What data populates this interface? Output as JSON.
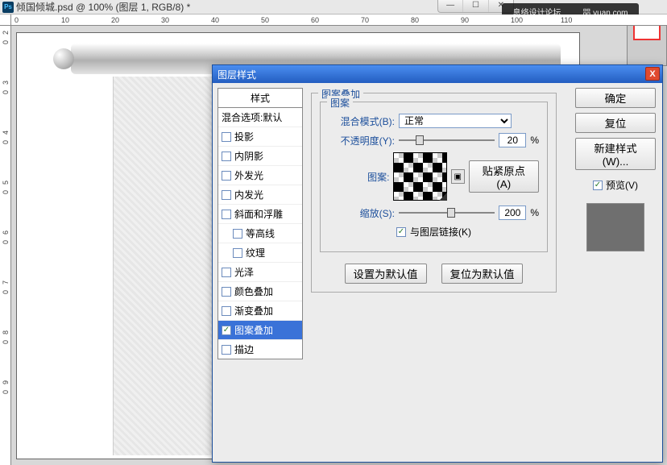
{
  "doc": {
    "title": "倾国倾城.psd @ 100% (图层 1, RGB/8) *",
    "ps": "Ps"
  },
  "win": {
    "min": "—",
    "max": "☐",
    "close": "✕"
  },
  "overlay": [
    "息络设计论坛",
    "㗊 yuan.com"
  ],
  "rulers": {
    "h": [
      "0",
      "10",
      "20",
      "30",
      "40",
      "50",
      "60",
      "70",
      "80",
      "90",
      "100",
      "110"
    ],
    "v": [
      "2",
      "0",
      "3",
      "0",
      "4",
      "0",
      "5",
      "0",
      "6",
      "0",
      "7",
      "0",
      "8",
      "0",
      "9",
      "0"
    ]
  },
  "dialog": {
    "title": "图层样式",
    "close": "X",
    "styles_header": "样式",
    "blend_opts": "混合选项:默认",
    "items": [
      {
        "label": "投影",
        "on": false
      },
      {
        "label": "内阴影",
        "on": false
      },
      {
        "label": "外发光",
        "on": false
      },
      {
        "label": "内发光",
        "on": false
      },
      {
        "label": "斜面和浮雕",
        "on": false
      },
      {
        "label": "等高线",
        "on": false,
        "indent": true
      },
      {
        "label": "纹理",
        "on": false,
        "indent": true
      },
      {
        "label": "光泽",
        "on": false
      },
      {
        "label": "颜色叠加",
        "on": false
      },
      {
        "label": "渐变叠加",
        "on": false
      },
      {
        "label": "图案叠加",
        "on": true,
        "sel": true
      },
      {
        "label": "描边",
        "on": false
      }
    ],
    "group_title": "图案叠加",
    "inner_title": "图案",
    "blend_mode_l": "混合模式(B):",
    "blend_mode_v": "正常",
    "opacity_l": "不透明度(Y):",
    "opacity_v": "20",
    "pct": "%",
    "pattern_l": "图案:",
    "snap_btn": "贴紧原点(A)",
    "scale_l": "缩放(S):",
    "scale_v": "200",
    "link_l": "与图层链接(K)",
    "set_default": "设置为默认值",
    "reset_default": "复位为默认值",
    "new_pattern_icon": "▣"
  },
  "rcol": {
    "ok": "确定",
    "reset": "复位",
    "newstyle": "新建样式(W)...",
    "preview": "预览(V)"
  }
}
